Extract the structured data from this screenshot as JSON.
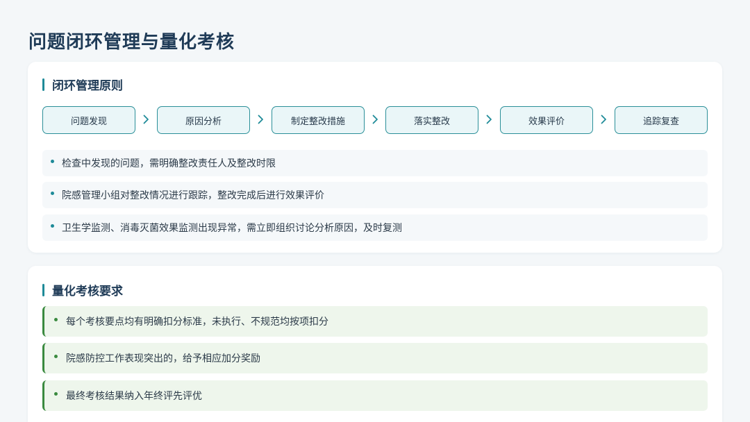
{
  "page": {
    "title": "问题闭环管理与量化考核"
  },
  "section1": {
    "title": "闭环管理原则",
    "steps": [
      "问题发现",
      "原因分析",
      "制定整改措施",
      "落实整改",
      "效果评价",
      "追踪复查"
    ],
    "bullets": [
      "检查中发现的问题，需明确整改责任人及整改时限",
      "院感管理小组对整改情况进行跟踪，整改完成后进行效果评价",
      "卫生学监测、消毒灭菌效果监测出现异常，需立即组织讨论分析原因，及时复测"
    ]
  },
  "section2": {
    "title": "量化考核要求",
    "bullets": [
      "每个考核要点均有明确扣分标准，未执行、不规范均按项扣分",
      "院感防控工作表现突出的，给予相应加分奖励",
      "最终考核结果纳入年终评先评优"
    ]
  },
  "colors": {
    "accent": "#1e8a98",
    "step_bg": "#eaf6f8",
    "green": "#3a8a3f",
    "green_bg": "#eef6ec"
  },
  "icons": {
    "flow_arrow": "chevron-right-icon",
    "bullet": "bullet-dot-icon"
  }
}
